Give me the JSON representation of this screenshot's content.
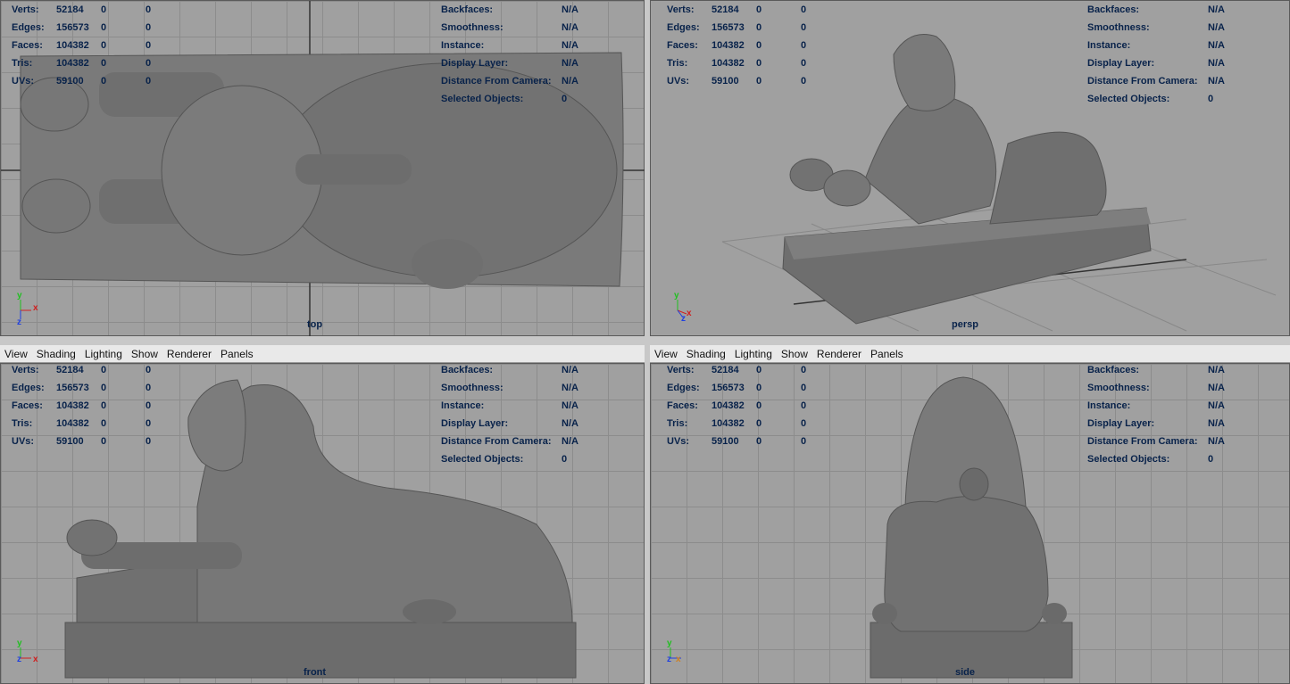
{
  "menu": [
    "View",
    "Shading",
    "Lighting",
    "Show",
    "Renderer",
    "Panels"
  ],
  "stats": [
    {
      "label": "Verts:",
      "value": "52184",
      "sel": "0",
      "comp": "0"
    },
    {
      "label": "Edges:",
      "value": "156573",
      "sel": "0",
      "comp": "0"
    },
    {
      "label": "Faces:",
      "value": "104382",
      "sel": "0",
      "comp": "0"
    },
    {
      "label": "Tris:",
      "value": "104382",
      "sel": "0",
      "comp": "0"
    },
    {
      "label": "UVs:",
      "value": "59100",
      "sel": "0",
      "comp": "0"
    }
  ],
  "info": [
    {
      "label": "Backfaces:",
      "value": "N/A"
    },
    {
      "label": "Smoothness:",
      "value": "N/A"
    },
    {
      "label": "Instance:",
      "value": "N/A"
    },
    {
      "label": "Display Layer:",
      "value": "N/A"
    },
    {
      "label": "Distance From Camera:",
      "value": "N/A"
    },
    {
      "label": "Selected Objects:",
      "value": "0"
    }
  ],
  "panels": {
    "top": {
      "camera": "top",
      "axes": [
        "y",
        "x",
        "z"
      ]
    },
    "persp": {
      "camera": "persp",
      "axes": [
        "y",
        "x",
        "z"
      ]
    },
    "front": {
      "camera": "front",
      "axes": [
        "y",
        "z",
        "x"
      ]
    },
    "side": {
      "camera": "side",
      "axes": [
        "y",
        "z",
        "x"
      ]
    }
  },
  "colors": {
    "viewport_bg": "#a0a0a0",
    "grid": "#8c8c8c",
    "hud_text": "#08224a",
    "axis_x": "#d02020",
    "axis_y": "#20c020",
    "axis_z": "#2040e0"
  }
}
